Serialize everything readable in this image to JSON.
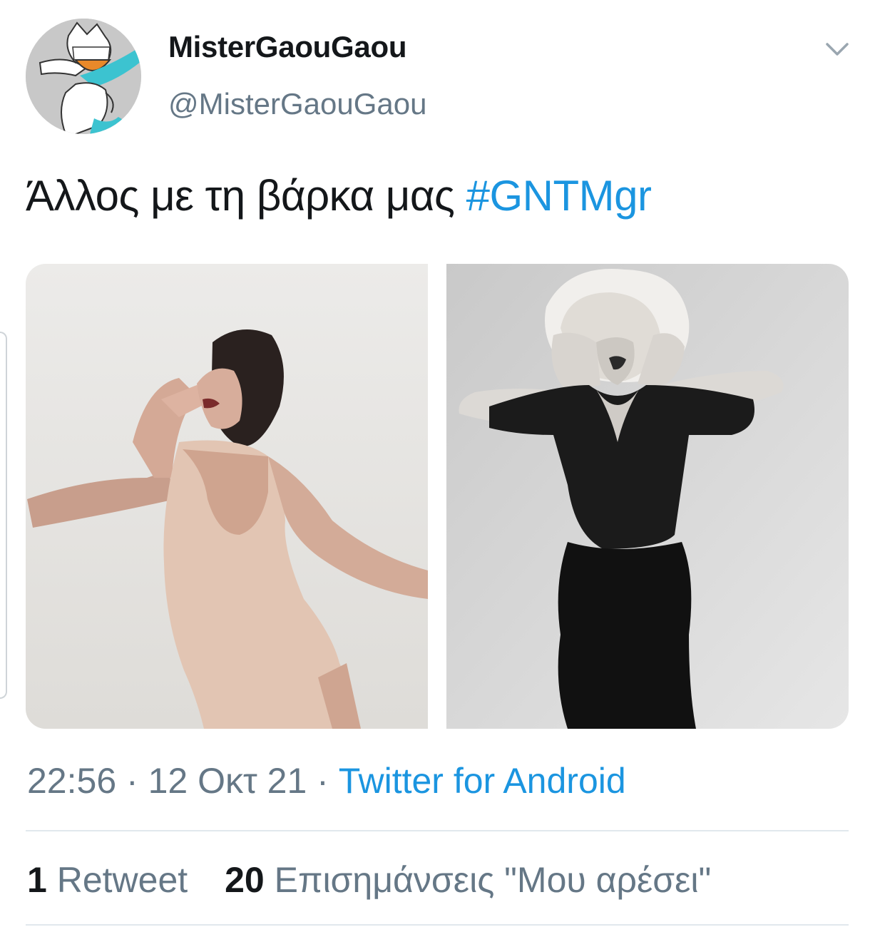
{
  "tweet": {
    "display_name": "MisterGaouGaou",
    "handle": "@MisterGaouGaou",
    "avatar_icon": "cartoon-character-avatar",
    "menu_icon": "chevron-down-icon",
    "text": "Άλλος με τη βάρκα μας",
    "hashtag": "#GNTMgr",
    "media": [
      {
        "description_icon": "photo-woman-in-beige-bodysuit-shouting"
      },
      {
        "description_icon": "photo-woman-in-black-dress-shouting"
      }
    ],
    "time": "22:56",
    "separator": "·",
    "date": "12 Οκτ 21",
    "source": "Twitter for Android",
    "retweet_count": "1",
    "retweet_label": "Retweet",
    "like_count": "20",
    "like_label": "Επισημάνσεις \"Μου αρέσει\""
  },
  "colors": {
    "link": "#1b95e0",
    "secondary_text": "#657786",
    "primary_text": "#14171a",
    "divider": "#e1e8ed"
  }
}
